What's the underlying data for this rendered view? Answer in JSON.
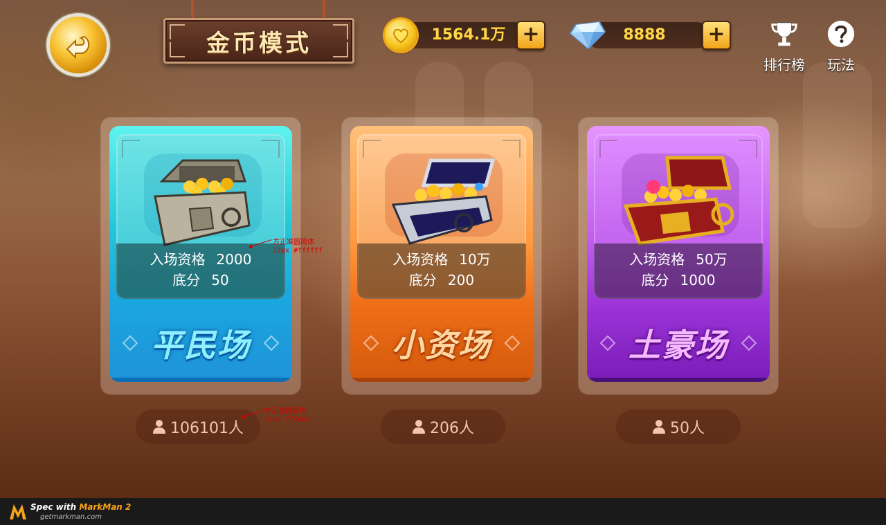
{
  "header": {
    "title": "金币模式",
    "coins": "1564.1万",
    "diamonds": "8888",
    "leaderboard_label": "排行榜",
    "help_label": "玩法"
  },
  "icons": {
    "back": "back-arrow-icon",
    "coin": "coin-heart-icon",
    "diamond": "diamond-icon",
    "add": "plus-icon",
    "leaderboard": "trophy-icon",
    "help": "question-mark-icon",
    "player": "person-icon"
  },
  "rooms": [
    {
      "name": "平民场",
      "entry_label": "入场资格",
      "entry_value": "2000",
      "base_label": "底分",
      "base_value": "50",
      "players": "106101人",
      "color": "#22c7d8"
    },
    {
      "name": "小资场",
      "entry_label": "入场资格",
      "entry_value": "10万",
      "base_label": "底分",
      "base_value": "200",
      "players": "206人",
      "color": "#ff9a3e"
    },
    {
      "name": "土豪场",
      "entry_label": "入场资格",
      "entry_value": "50万",
      "base_label": "底分",
      "base_value": "1000",
      "players": "50人",
      "color": "#c25df0"
    }
  ],
  "annotations": [
    {
      "line1": "方正准圆简体",
      "line2": "22px  #ffffff"
    },
    {
      "line1": "方正准圆简体",
      "line2": "22px  f7c4ad"
    }
  ],
  "footer": {
    "spec_prefix": "Spec with ",
    "brand": "MarkMan 2",
    "site": "getmarkman.com"
  },
  "colors": {
    "gold_text": "#ffd84a",
    "player_text": "#f7c4ad",
    "title_text": "#fde7b2"
  }
}
